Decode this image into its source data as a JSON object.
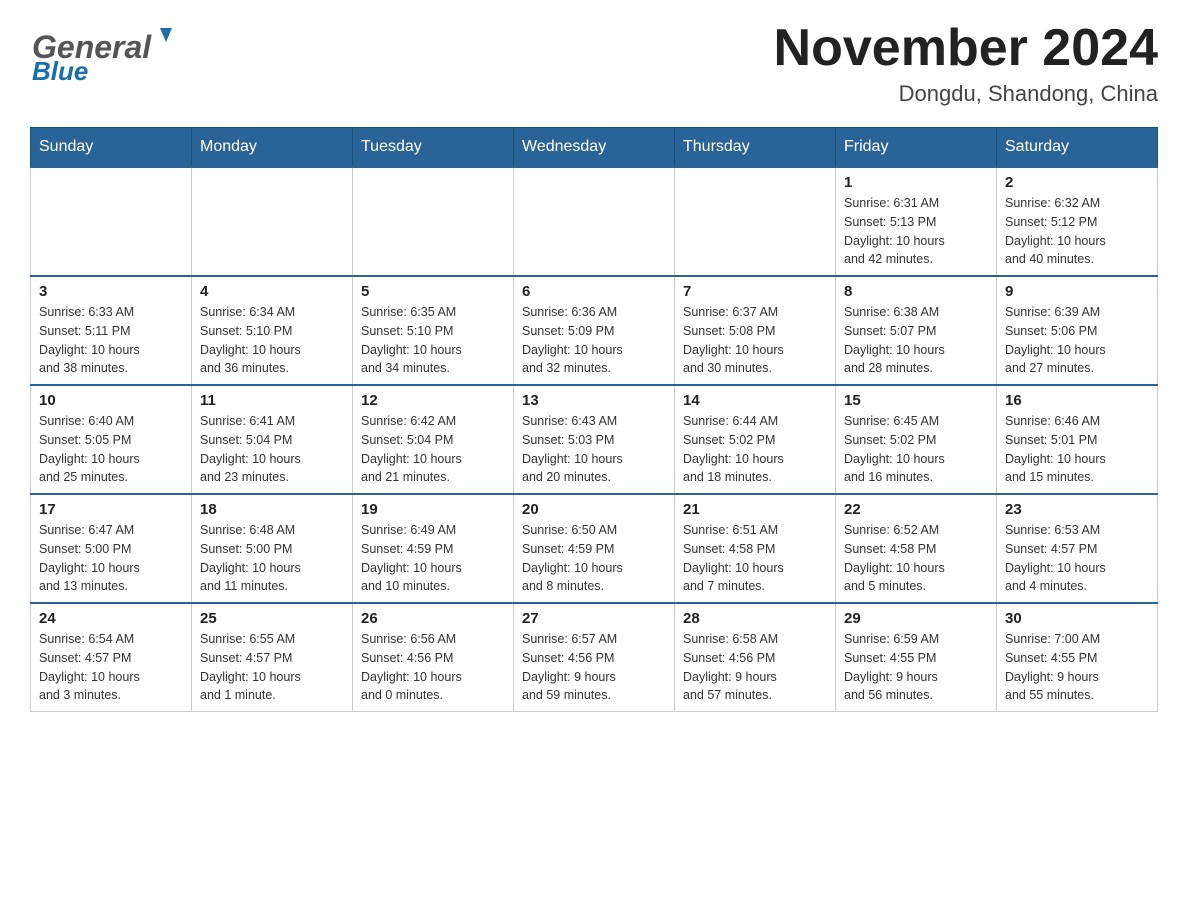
{
  "header": {
    "month_title": "November 2024",
    "location": "Dongdu, Shandong, China"
  },
  "days_of_week": [
    "Sunday",
    "Monday",
    "Tuesday",
    "Wednesday",
    "Thursday",
    "Friday",
    "Saturday"
  ],
  "weeks": [
    {
      "days": [
        {
          "number": "",
          "info": ""
        },
        {
          "number": "",
          "info": ""
        },
        {
          "number": "",
          "info": ""
        },
        {
          "number": "",
          "info": ""
        },
        {
          "number": "",
          "info": ""
        },
        {
          "number": "1",
          "info": "Sunrise: 6:31 AM\nSunset: 5:13 PM\nDaylight: 10 hours\nand 42 minutes."
        },
        {
          "number": "2",
          "info": "Sunrise: 6:32 AM\nSunset: 5:12 PM\nDaylight: 10 hours\nand 40 minutes."
        }
      ]
    },
    {
      "days": [
        {
          "number": "3",
          "info": "Sunrise: 6:33 AM\nSunset: 5:11 PM\nDaylight: 10 hours\nand 38 minutes."
        },
        {
          "number": "4",
          "info": "Sunrise: 6:34 AM\nSunset: 5:10 PM\nDaylight: 10 hours\nand 36 minutes."
        },
        {
          "number": "5",
          "info": "Sunrise: 6:35 AM\nSunset: 5:10 PM\nDaylight: 10 hours\nand 34 minutes."
        },
        {
          "number": "6",
          "info": "Sunrise: 6:36 AM\nSunset: 5:09 PM\nDaylight: 10 hours\nand 32 minutes."
        },
        {
          "number": "7",
          "info": "Sunrise: 6:37 AM\nSunset: 5:08 PM\nDaylight: 10 hours\nand 30 minutes."
        },
        {
          "number": "8",
          "info": "Sunrise: 6:38 AM\nSunset: 5:07 PM\nDaylight: 10 hours\nand 28 minutes."
        },
        {
          "number": "9",
          "info": "Sunrise: 6:39 AM\nSunset: 5:06 PM\nDaylight: 10 hours\nand 27 minutes."
        }
      ]
    },
    {
      "days": [
        {
          "number": "10",
          "info": "Sunrise: 6:40 AM\nSunset: 5:05 PM\nDaylight: 10 hours\nand 25 minutes."
        },
        {
          "number": "11",
          "info": "Sunrise: 6:41 AM\nSunset: 5:04 PM\nDaylight: 10 hours\nand 23 minutes."
        },
        {
          "number": "12",
          "info": "Sunrise: 6:42 AM\nSunset: 5:04 PM\nDaylight: 10 hours\nand 21 minutes."
        },
        {
          "number": "13",
          "info": "Sunrise: 6:43 AM\nSunset: 5:03 PM\nDaylight: 10 hours\nand 20 minutes."
        },
        {
          "number": "14",
          "info": "Sunrise: 6:44 AM\nSunset: 5:02 PM\nDaylight: 10 hours\nand 18 minutes."
        },
        {
          "number": "15",
          "info": "Sunrise: 6:45 AM\nSunset: 5:02 PM\nDaylight: 10 hours\nand 16 minutes."
        },
        {
          "number": "16",
          "info": "Sunrise: 6:46 AM\nSunset: 5:01 PM\nDaylight: 10 hours\nand 15 minutes."
        }
      ]
    },
    {
      "days": [
        {
          "number": "17",
          "info": "Sunrise: 6:47 AM\nSunset: 5:00 PM\nDaylight: 10 hours\nand 13 minutes."
        },
        {
          "number": "18",
          "info": "Sunrise: 6:48 AM\nSunset: 5:00 PM\nDaylight: 10 hours\nand 11 minutes."
        },
        {
          "number": "19",
          "info": "Sunrise: 6:49 AM\nSunset: 4:59 PM\nDaylight: 10 hours\nand 10 minutes."
        },
        {
          "number": "20",
          "info": "Sunrise: 6:50 AM\nSunset: 4:59 PM\nDaylight: 10 hours\nand 8 minutes."
        },
        {
          "number": "21",
          "info": "Sunrise: 6:51 AM\nSunset: 4:58 PM\nDaylight: 10 hours\nand 7 minutes."
        },
        {
          "number": "22",
          "info": "Sunrise: 6:52 AM\nSunset: 4:58 PM\nDaylight: 10 hours\nand 5 minutes."
        },
        {
          "number": "23",
          "info": "Sunrise: 6:53 AM\nSunset: 4:57 PM\nDaylight: 10 hours\nand 4 minutes."
        }
      ]
    },
    {
      "days": [
        {
          "number": "24",
          "info": "Sunrise: 6:54 AM\nSunset: 4:57 PM\nDaylight: 10 hours\nand 3 minutes."
        },
        {
          "number": "25",
          "info": "Sunrise: 6:55 AM\nSunset: 4:57 PM\nDaylight: 10 hours\nand 1 minute."
        },
        {
          "number": "26",
          "info": "Sunrise: 6:56 AM\nSunset: 4:56 PM\nDaylight: 10 hours\nand 0 minutes."
        },
        {
          "number": "27",
          "info": "Sunrise: 6:57 AM\nSunset: 4:56 PM\nDaylight: 9 hours\nand 59 minutes."
        },
        {
          "number": "28",
          "info": "Sunrise: 6:58 AM\nSunset: 4:56 PM\nDaylight: 9 hours\nand 57 minutes."
        },
        {
          "number": "29",
          "info": "Sunrise: 6:59 AM\nSunset: 4:55 PM\nDaylight: 9 hours\nand 56 minutes."
        },
        {
          "number": "30",
          "info": "Sunrise: 7:00 AM\nSunset: 4:55 PM\nDaylight: 9 hours\nand 55 minutes."
        }
      ]
    }
  ]
}
